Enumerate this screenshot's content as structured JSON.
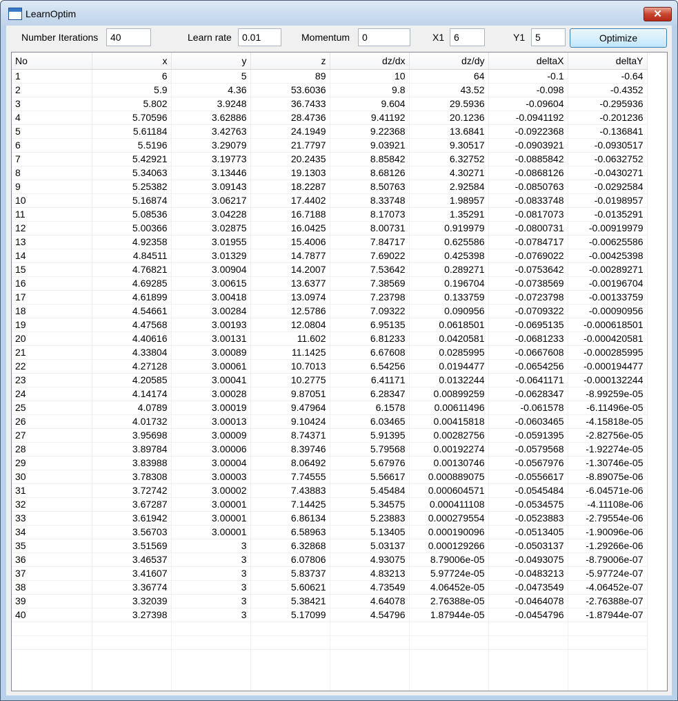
{
  "window": {
    "title": "LearnOptim",
    "close_label": "✕"
  },
  "toolbar": {
    "iterations_label": "Number Iterations",
    "iterations_value": "40",
    "learn_rate_label": "Learn rate",
    "learn_rate_value": "0.01",
    "momentum_label": "Momentum",
    "momentum_value": "0",
    "x1_label": "X1",
    "x1_value": "6",
    "y1_label": "Y1",
    "y1_value": "5",
    "optimize_label": "Optimize"
  },
  "icons": {
    "app": "window-icon",
    "close": "close-icon"
  },
  "colors": {
    "title_bar": "#bed3ea",
    "close_button": "#c7452f",
    "optimize_border": "#3c7fb1"
  },
  "table": {
    "columns": [
      "No",
      "x",
      "y",
      "z",
      "dz/dx",
      "dz/dy",
      "deltaX",
      "deltaY"
    ],
    "rows": [
      [
        "1",
        "6",
        "5",
        "89",
        "10",
        "64",
        "-0.1",
        "-0.64"
      ],
      [
        "2",
        "5.9",
        "4.36",
        "53.6036",
        "9.8",
        "43.52",
        "-0.098",
        "-0.4352"
      ],
      [
        "3",
        "5.802",
        "3.9248",
        "36.7433",
        "9.604",
        "29.5936",
        "-0.09604",
        "-0.295936"
      ],
      [
        "4",
        "5.70596",
        "3.62886",
        "28.4736",
        "9.41192",
        "20.1236",
        "-0.0941192",
        "-0.201236"
      ],
      [
        "5",
        "5.61184",
        "3.42763",
        "24.1949",
        "9.22368",
        "13.6841",
        "-0.0922368",
        "-0.136841"
      ],
      [
        "6",
        "5.5196",
        "3.29079",
        "21.7797",
        "9.03921",
        "9.30517",
        "-0.0903921",
        "-0.0930517"
      ],
      [
        "7",
        "5.42921",
        "3.19773",
        "20.2435",
        "8.85842",
        "6.32752",
        "-0.0885842",
        "-0.0632752"
      ],
      [
        "8",
        "5.34063",
        "3.13446",
        "19.1303",
        "8.68126",
        "4.30271",
        "-0.0868126",
        "-0.0430271"
      ],
      [
        "9",
        "5.25382",
        "3.09143",
        "18.2287",
        "8.50763",
        "2.92584",
        "-0.0850763",
        "-0.0292584"
      ],
      [
        "10",
        "5.16874",
        "3.06217",
        "17.4402",
        "8.33748",
        "1.98957",
        "-0.0833748",
        "-0.0198957"
      ],
      [
        "11",
        "5.08536",
        "3.04228",
        "16.7188",
        "8.17073",
        "1.35291",
        "-0.0817073",
        "-0.0135291"
      ],
      [
        "12",
        "5.00366",
        "3.02875",
        "16.0425",
        "8.00731",
        "0.919979",
        "-0.0800731",
        "-0.00919979"
      ],
      [
        "13",
        "4.92358",
        "3.01955",
        "15.4006",
        "7.84717",
        "0.625586",
        "-0.0784717",
        "-0.00625586"
      ],
      [
        "14",
        "4.84511",
        "3.01329",
        "14.7877",
        "7.69022",
        "0.425398",
        "-0.0769022",
        "-0.00425398"
      ],
      [
        "15",
        "4.76821",
        "3.00904",
        "14.2007",
        "7.53642",
        "0.289271",
        "-0.0753642",
        "-0.00289271"
      ],
      [
        "16",
        "4.69285",
        "3.00615",
        "13.6377",
        "7.38569",
        "0.196704",
        "-0.0738569",
        "-0.00196704"
      ],
      [
        "17",
        "4.61899",
        "3.00418",
        "13.0974",
        "7.23798",
        "0.133759",
        "-0.0723798",
        "-0.00133759"
      ],
      [
        "18",
        "4.54661",
        "3.00284",
        "12.5786",
        "7.09322",
        "0.090956",
        "-0.0709322",
        "-0.00090956"
      ],
      [
        "19",
        "4.47568",
        "3.00193",
        "12.0804",
        "6.95135",
        "0.0618501",
        "-0.0695135",
        "-0.000618501"
      ],
      [
        "20",
        "4.40616",
        "3.00131",
        "11.602",
        "6.81233",
        "0.0420581",
        "-0.0681233",
        "-0.000420581"
      ],
      [
        "21",
        "4.33804",
        "3.00089",
        "11.1425",
        "6.67608",
        "0.0285995",
        "-0.0667608",
        "-0.000285995"
      ],
      [
        "22",
        "4.27128",
        "3.00061",
        "10.7013",
        "6.54256",
        "0.0194477",
        "-0.0654256",
        "-0.000194477"
      ],
      [
        "23",
        "4.20585",
        "3.00041",
        "10.2775",
        "6.41171",
        "0.0132244",
        "-0.0641171",
        "-0.000132244"
      ],
      [
        "24",
        "4.14174",
        "3.00028",
        "9.87051",
        "6.28347",
        "0.00899259",
        "-0.0628347",
        "-8.99259e-05"
      ],
      [
        "25",
        "4.0789",
        "3.00019",
        "9.47964",
        "6.1578",
        "0.00611496",
        "-0.061578",
        "-6.11496e-05"
      ],
      [
        "26",
        "4.01732",
        "3.00013",
        "9.10424",
        "6.03465",
        "0.00415818",
        "-0.0603465",
        "-4.15818e-05"
      ],
      [
        "27",
        "3.95698",
        "3.00009",
        "8.74371",
        "5.91395",
        "0.00282756",
        "-0.0591395",
        "-2.82756e-05"
      ],
      [
        "28",
        "3.89784",
        "3.00006",
        "8.39746",
        "5.79568",
        "0.00192274",
        "-0.0579568",
        "-1.92274e-05"
      ],
      [
        "29",
        "3.83988",
        "3.00004",
        "8.06492",
        "5.67976",
        "0.00130746",
        "-0.0567976",
        "-1.30746e-05"
      ],
      [
        "30",
        "3.78308",
        "3.00003",
        "7.74555",
        "5.56617",
        "0.000889075",
        "-0.0556617",
        "-8.89075e-06"
      ],
      [
        "31",
        "3.72742",
        "3.00002",
        "7.43883",
        "5.45484",
        "0.000604571",
        "-0.0545484",
        "-6.04571e-06"
      ],
      [
        "32",
        "3.67287",
        "3.00001",
        "7.14425",
        "5.34575",
        "0.000411108",
        "-0.0534575",
        "-4.11108e-06"
      ],
      [
        "33",
        "3.61942",
        "3.00001",
        "6.86134",
        "5.23883",
        "0.000279554",
        "-0.0523883",
        "-2.79554e-06"
      ],
      [
        "34",
        "3.56703",
        "3.00001",
        "6.58963",
        "5.13405",
        "0.000190096",
        "-0.0513405",
        "-1.90096e-06"
      ],
      [
        "35",
        "3.51569",
        "3",
        "6.32868",
        "5.03137",
        "0.000129266",
        "-0.0503137",
        "-1.29266e-06"
      ],
      [
        "36",
        "3.46537",
        "3",
        "6.07806",
        "4.93075",
        "8.79006e-05",
        "-0.0493075",
        "-8.79006e-07"
      ],
      [
        "37",
        "3.41607",
        "3",
        "5.83737",
        "4.83213",
        "5.97724e-05",
        "-0.0483213",
        "-5.97724e-07"
      ],
      [
        "38",
        "3.36774",
        "3",
        "5.60621",
        "4.73549",
        "4.06452e-05",
        "-0.0473549",
        "-4.06452e-07"
      ],
      [
        "39",
        "3.32039",
        "3",
        "5.38421",
        "4.64078",
        "2.76388e-05",
        "-0.0464078",
        "-2.76388e-07"
      ],
      [
        "40",
        "3.27398",
        "3",
        "5.17099",
        "4.54796",
        "1.87944e-05",
        "-0.0454796",
        "-1.87944e-07"
      ]
    ]
  }
}
